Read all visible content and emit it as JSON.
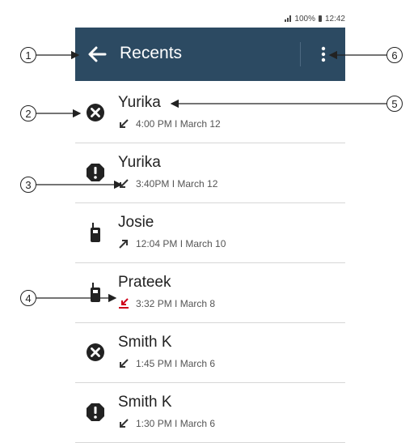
{
  "status_bar": {
    "battery": "100%",
    "time": "12:42"
  },
  "app_bar": {
    "title": "Recents",
    "back_icon": "arrow-left-icon",
    "menu_icon": "more-vert-icon"
  },
  "recents": [
    {
      "name": "Yurika",
      "time": "4:00 PM I March 12",
      "type_icon": "missed-call-icon",
      "direction_icon": "incoming-arrow-icon"
    },
    {
      "name": "Yurika",
      "time": "3:40PM I March 12",
      "type_icon": "emergency-alert-icon",
      "direction_icon": "incoming-arrow-icon"
    },
    {
      "name": "Josie",
      "time": "12:04 PM I March 10",
      "type_icon": "radio-icon",
      "direction_icon": "outgoing-arrow-icon"
    },
    {
      "name": "Prateek",
      "time": "3:32 PM I March 8",
      "type_icon": "radio-icon",
      "direction_icon": "missed-incoming-icon"
    },
    {
      "name": "Smith K",
      "time": "1:45 PM I March 6",
      "type_icon": "missed-call-icon",
      "direction_icon": "incoming-arrow-icon"
    },
    {
      "name": "Smith K",
      "time": "1:30 PM I March 6",
      "type_icon": "emergency-alert-icon",
      "direction_icon": "incoming-arrow-icon"
    }
  ],
  "callouts": [
    "1",
    "2",
    "3",
    "4",
    "5",
    "6"
  ],
  "colors": {
    "app_bar": "#2c4a62",
    "missed_indicator": "#d0021b",
    "icon": "#222222"
  }
}
